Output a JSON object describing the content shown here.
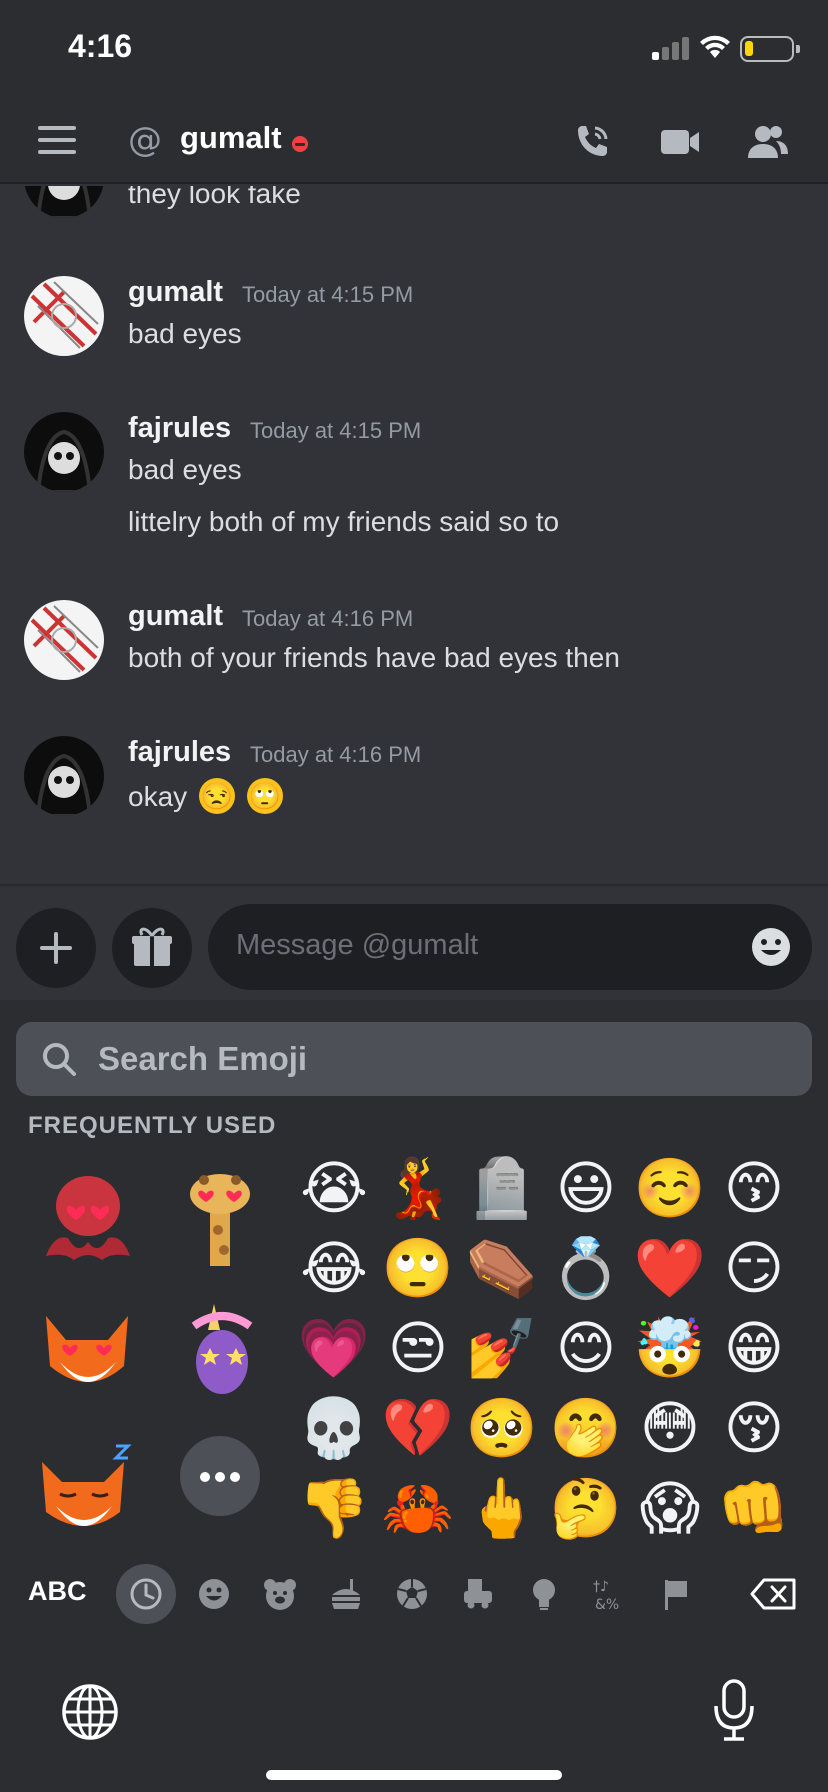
{
  "status_bar": {
    "time": "4:16"
  },
  "header": {
    "at_symbol": "@",
    "name": "gumalt",
    "status": "do-not-disturb"
  },
  "messages": [
    {
      "text": "they look fake"
    },
    {
      "author": "gumalt",
      "timestamp": "Today at 4:15 PM",
      "lines": [
        "bad eyes"
      ]
    },
    {
      "author": "fajrules",
      "timestamp": "Today at 4:15 PM",
      "lines": [
        "bad eyes",
        "littelry both of my friends said so to"
      ]
    },
    {
      "author": "gumalt",
      "timestamp": "Today at 4:16 PM",
      "lines": [
        "both of your friends have bad eyes then"
      ]
    },
    {
      "author": "fajrules",
      "timestamp": "Today at 4:16 PM",
      "lines": [
        "okay"
      ],
      "emojis": [
        "😒",
        "🙄"
      ]
    }
  ],
  "input": {
    "placeholder": "Message @gumalt"
  },
  "emoji_picker": {
    "search_placeholder": "Search Emoji",
    "section_title": "FREQUENTLY USED",
    "memoji": [
      "heart-eyes-octopus",
      "heart-eyes-giraffe",
      "heart-eyes-fox",
      "star-eyes-unicorn",
      "sleeping-fox"
    ],
    "emojis": [
      [
        "😭",
        "💃",
        "🪦",
        "😃",
        "☺️",
        "😙"
      ],
      [
        "😂",
        "🙄",
        "⚰️",
        "💍",
        "❤️",
        "😏"
      ],
      [
        "💗",
        "😒",
        "💅",
        "😊",
        "🤯",
        "😁"
      ],
      [
        "💀",
        "💔",
        "🥺",
        "🤭",
        "😳",
        "😚"
      ],
      [
        "👎",
        "🦀",
        "🖕",
        "🤔",
        "😱",
        "👊"
      ]
    ],
    "abc_label": "ABC",
    "categories": [
      "recent-icon",
      "smiley-icon",
      "bear-icon",
      "food-icon",
      "ball-icon",
      "travel-icon",
      "bulb-icon",
      "symbols-icon",
      "flag-icon"
    ]
  },
  "colors": {
    "background": "#313338",
    "header": "#2b2d31",
    "dnd": "#f23f43",
    "battery": "#ffd60a"
  }
}
